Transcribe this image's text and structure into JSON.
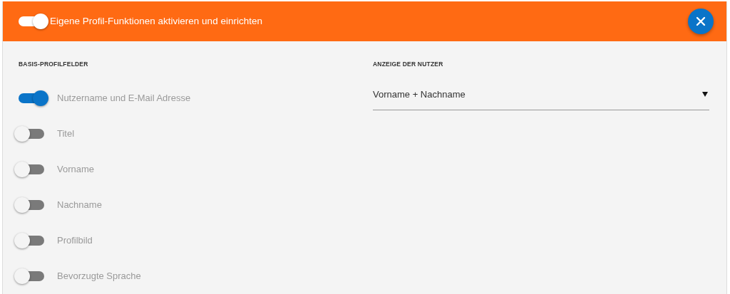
{
  "header": {
    "toggle_on": true,
    "title": "Eigene Profil-Funktionen aktivieren und einrichten"
  },
  "basic_fields": {
    "heading": "BASIS-PROFILFELDER",
    "fields": [
      {
        "label": "Nutzername und E-Mail Adresse",
        "on": true
      },
      {
        "label": "Titel",
        "on": false
      },
      {
        "label": "Vorname",
        "on": false
      },
      {
        "label": "Nachname",
        "on": false
      },
      {
        "label": "Profilbild",
        "on": false
      },
      {
        "label": "Bevorzugte Sprache",
        "on": false
      }
    ]
  },
  "user_display": {
    "heading": "ANZEIGE DER NUTZER",
    "value": "Vorname + Nachname"
  }
}
